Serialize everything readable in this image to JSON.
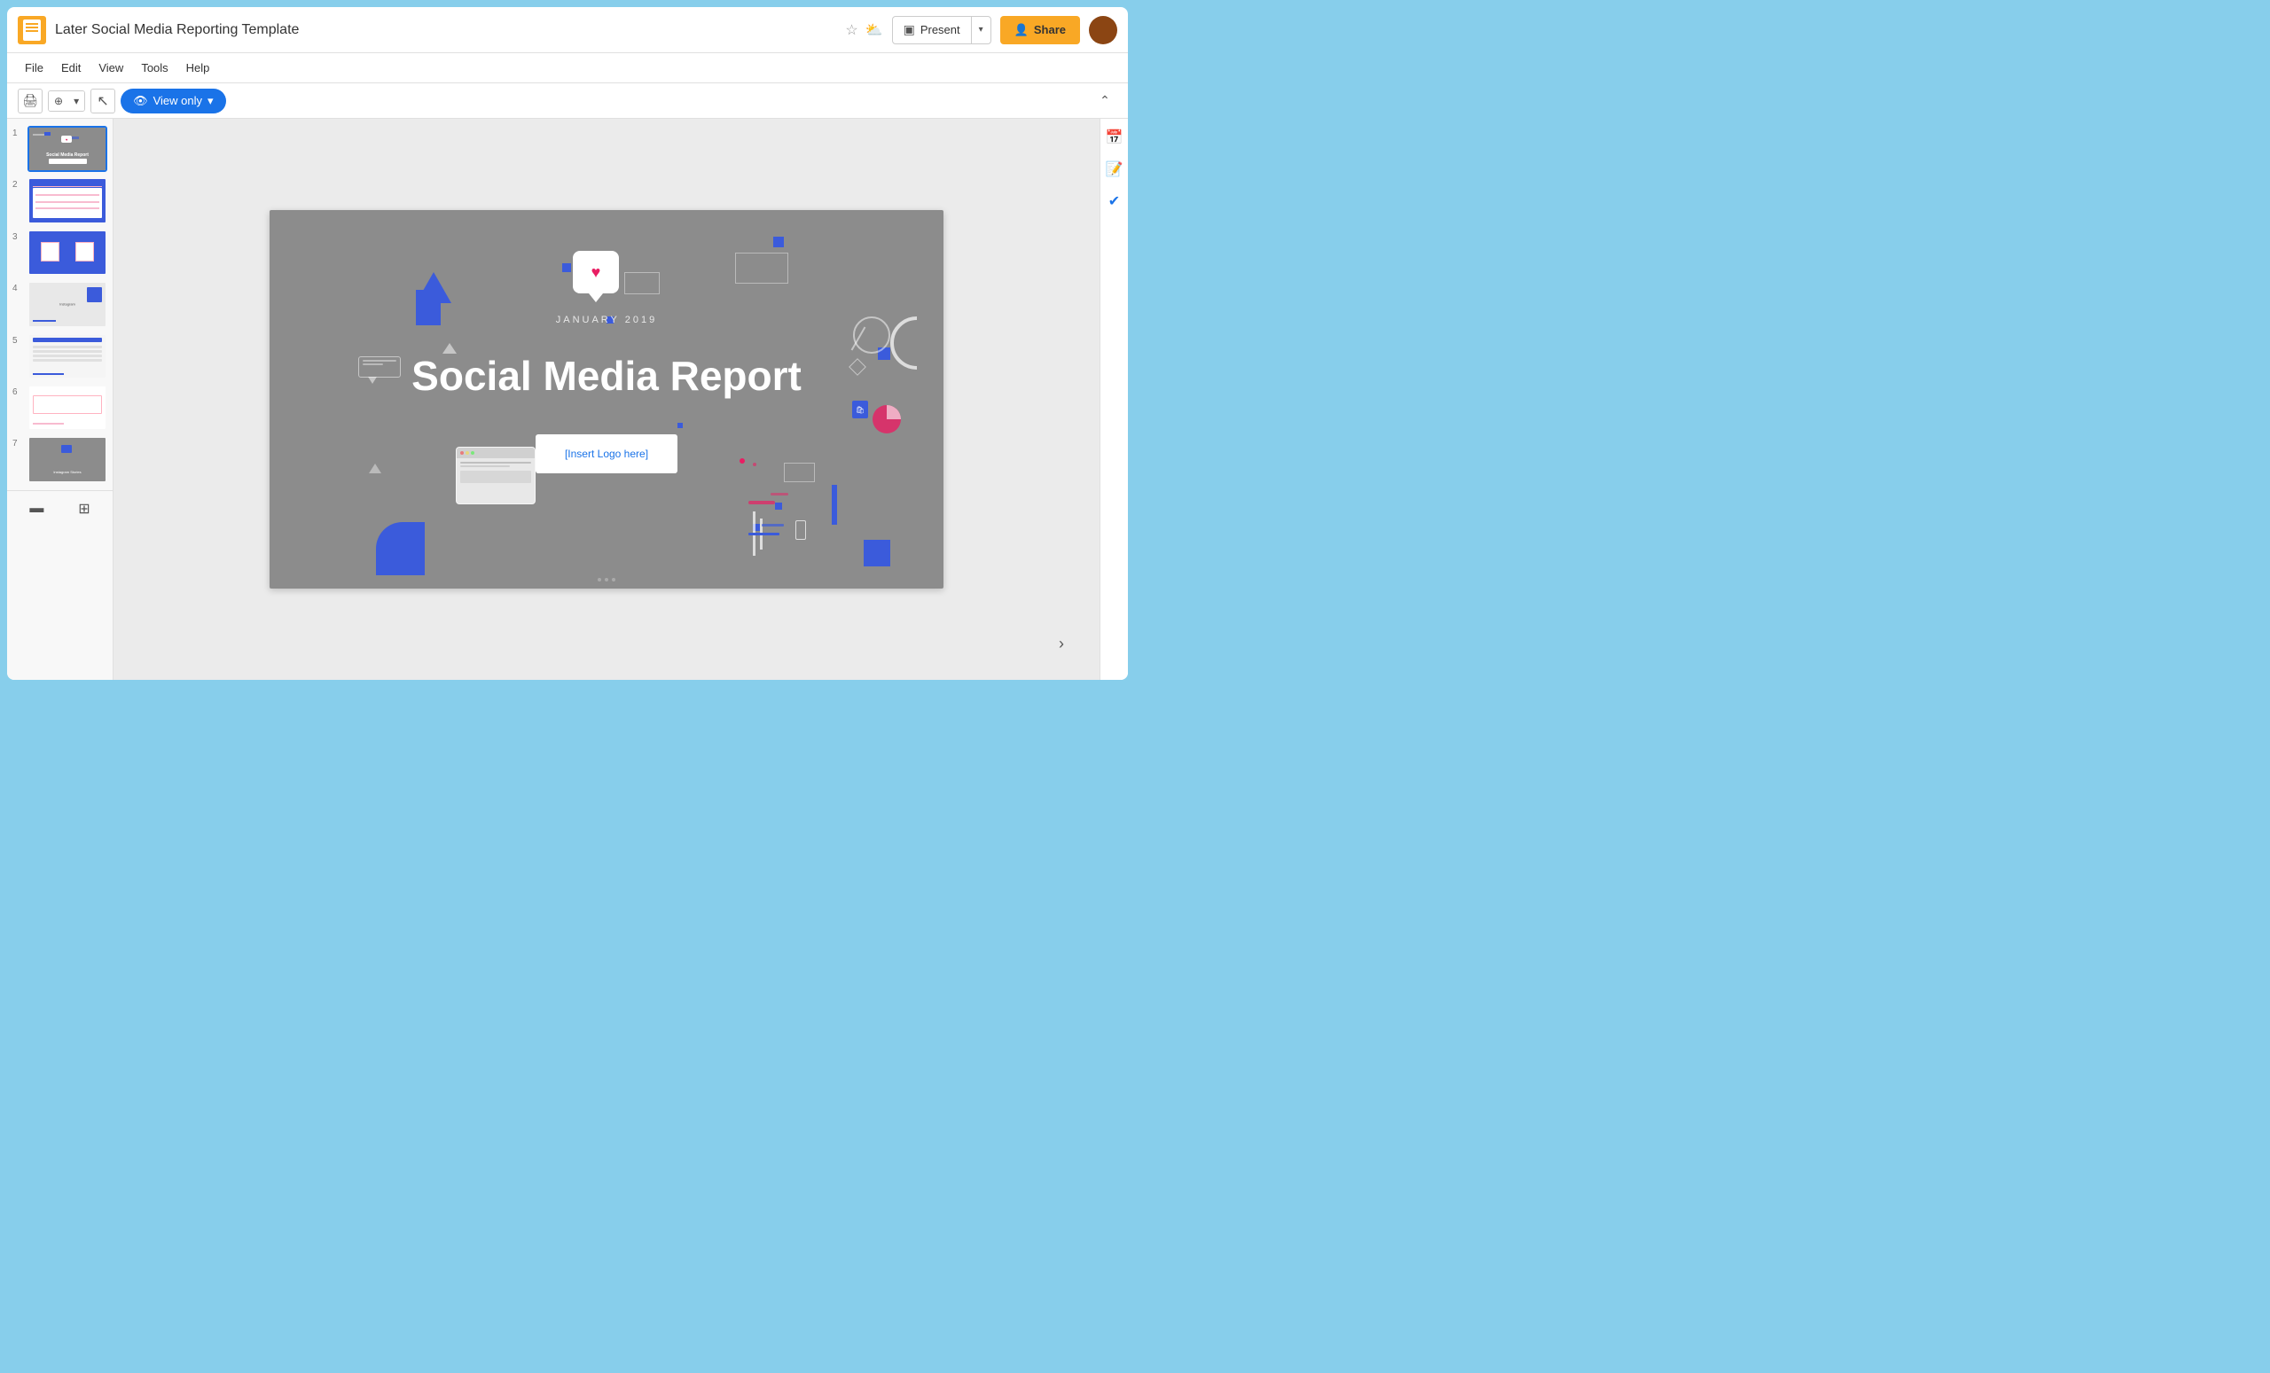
{
  "app": {
    "title": "Later Social Media Reporting Template",
    "doc_icon_color": "#F9A825"
  },
  "titlebar": {
    "title": "Later Social Media Reporting Template",
    "star_icon": "☆",
    "cloud_icon": "☁"
  },
  "header_right": {
    "present_label": "Present",
    "present_icon": "▣",
    "dropdown_arrow": "▼",
    "share_label": "Share",
    "share_icon": "👤"
  },
  "menubar": {
    "items": [
      "File",
      "Edit",
      "View",
      "Tools",
      "Help"
    ]
  },
  "toolbar": {
    "print_icon": "🖨",
    "zoom_icon": "⊕",
    "zoom_dropdown": "▾",
    "cursor_icon": "↖",
    "view_only_label": "View only",
    "eye_icon": "👁",
    "dropdown_icon": "▾",
    "collapse_icon": "⌃"
  },
  "slides": [
    {
      "number": "1",
      "active": true,
      "title": "Social Media Report",
      "type": "title_slide"
    },
    {
      "number": "2",
      "active": false,
      "type": "table_slide"
    },
    {
      "number": "3",
      "active": false,
      "type": "comparison_slide"
    },
    {
      "number": "4",
      "active": false,
      "type": "instagram_label",
      "label": "Instagram"
    },
    {
      "number": "5",
      "active": false,
      "type": "data_table"
    },
    {
      "number": "6",
      "active": false,
      "type": "content_slide"
    },
    {
      "number": "7",
      "active": false,
      "type": "instagram_stories",
      "label": "Instagram Stories"
    }
  ],
  "main_slide": {
    "subtitle": "JANUARY 2019",
    "main_title": "Social Media Report",
    "logo_placeholder": "[Insert Logo here]"
  },
  "slide_panel_bottom": {
    "list_icon": "≡",
    "grid_icon": "⊞"
  },
  "right_sidebar": {
    "calendar_icon": "📅",
    "task_icon": "✔",
    "check_icon": "✓"
  },
  "right_arrow": "›",
  "slide_dots": [
    "•",
    "•",
    "•"
  ]
}
